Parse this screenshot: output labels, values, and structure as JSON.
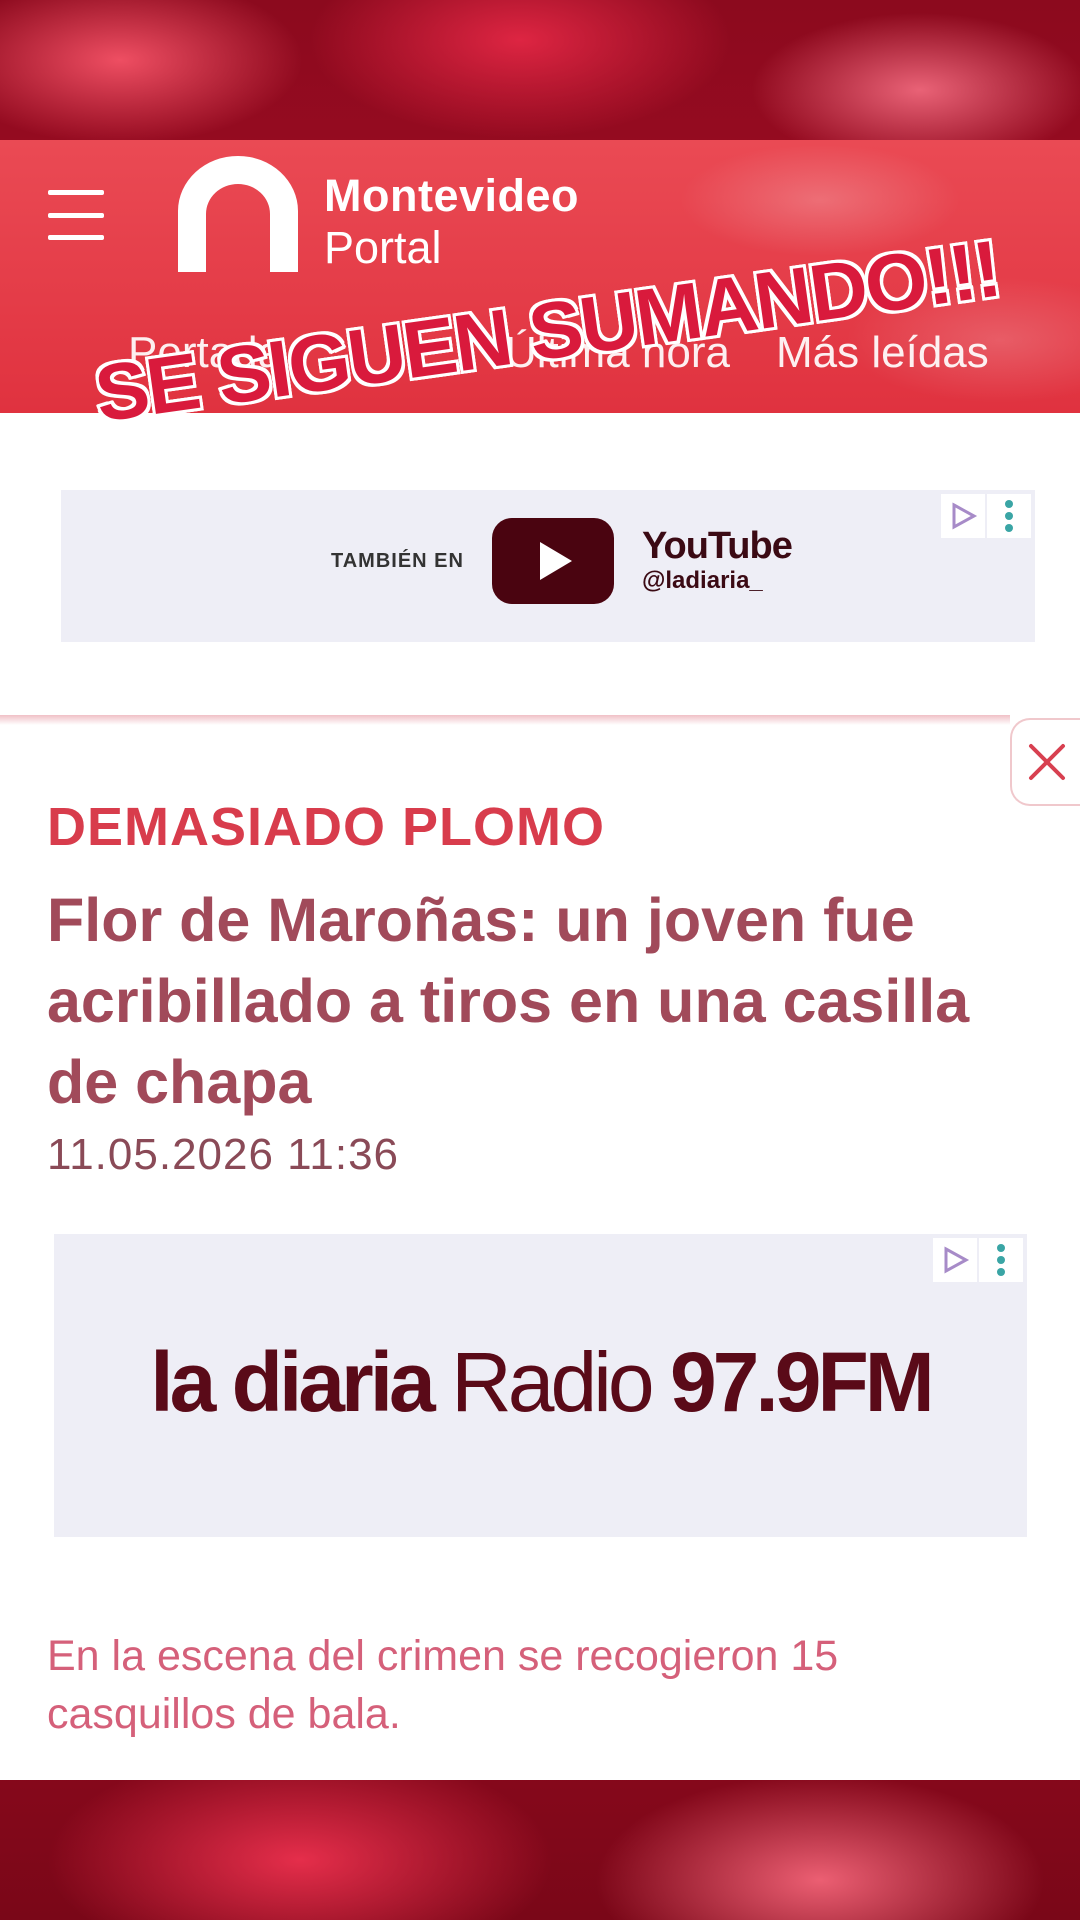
{
  "brand": {
    "name_line1": "Montevideo",
    "name_line2": "Portal"
  },
  "nav": {
    "tabs": [
      "Portada",
      "Última hora",
      "Más leídas"
    ]
  },
  "overlay": {
    "text": "SE SIGUEN SUMANDO!!!"
  },
  "ad_youtube": {
    "prefix": "TAMBIÉN EN",
    "platform": "YouTube",
    "handle": "@ladiaria_"
  },
  "article": {
    "kicker": "DEMASIADO PLOMO",
    "headline": "Flor de Maroñas: un joven fue acribillado a tiros en una casilla de chapa",
    "timestamp": "11.05.2026 11:36",
    "lead": "En la escena del crimen se recogieron 15 casquillos de bala."
  },
  "ad_radio": {
    "brand": "la diaria",
    "radio": "Radio",
    "frequency": "97.9FM"
  },
  "icons": {
    "menu": "hamburger-icon",
    "ad_choices": "ad-choices-icon",
    "ad_more": "kebab-menu-icon",
    "close": "close-icon",
    "play": "play-icon"
  },
  "colors": {
    "header": "#e0323f",
    "kicker": "#d83c4c",
    "headline": "#a14a5a",
    "overlay": "#d91a3c"
  }
}
